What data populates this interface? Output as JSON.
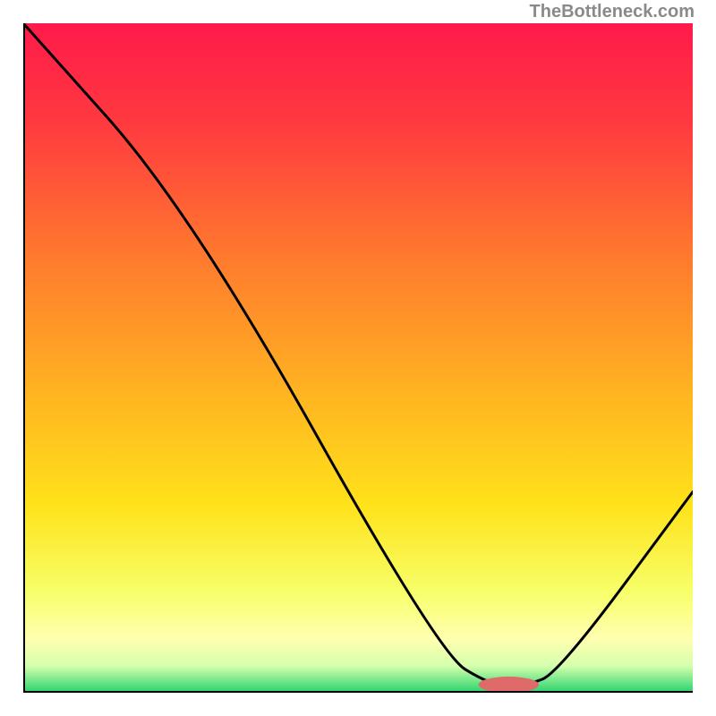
{
  "attribution": "TheBottleneck.com",
  "chart_data": {
    "type": "line",
    "title": "",
    "xlabel": "",
    "ylabel": "",
    "xlim": [
      0,
      100
    ],
    "ylim": [
      0,
      100
    ],
    "grid": false,
    "series": [
      {
        "name": "curve",
        "x": [
          0,
          25,
          62,
          70,
          75,
          80,
          100
        ],
        "y": [
          100,
          72,
          6,
          1,
          1,
          3,
          30
        ]
      }
    ],
    "marker": {
      "cx": 72.5,
      "cy": 1.2,
      "rx": 4.5,
      "ry": 1.2,
      "color": "#e06a6a"
    },
    "background": {
      "type": "vertical-gradient",
      "stops": [
        {
          "offset": 0.0,
          "color": "#ff1a4b"
        },
        {
          "offset": 0.15,
          "color": "#ff3a3f"
        },
        {
          "offset": 0.35,
          "color": "#ff7a2e"
        },
        {
          "offset": 0.55,
          "color": "#ffb321"
        },
        {
          "offset": 0.72,
          "color": "#ffe21a"
        },
        {
          "offset": 0.85,
          "color": "#f7ff6a"
        },
        {
          "offset": 0.92,
          "color": "#ffffb0"
        },
        {
          "offset": 0.96,
          "color": "#d4ffad"
        },
        {
          "offset": 1.0,
          "color": "#27d36d"
        }
      ]
    },
    "axis_color": "#000000",
    "line_color": "#000000",
    "line_width": 3
  }
}
